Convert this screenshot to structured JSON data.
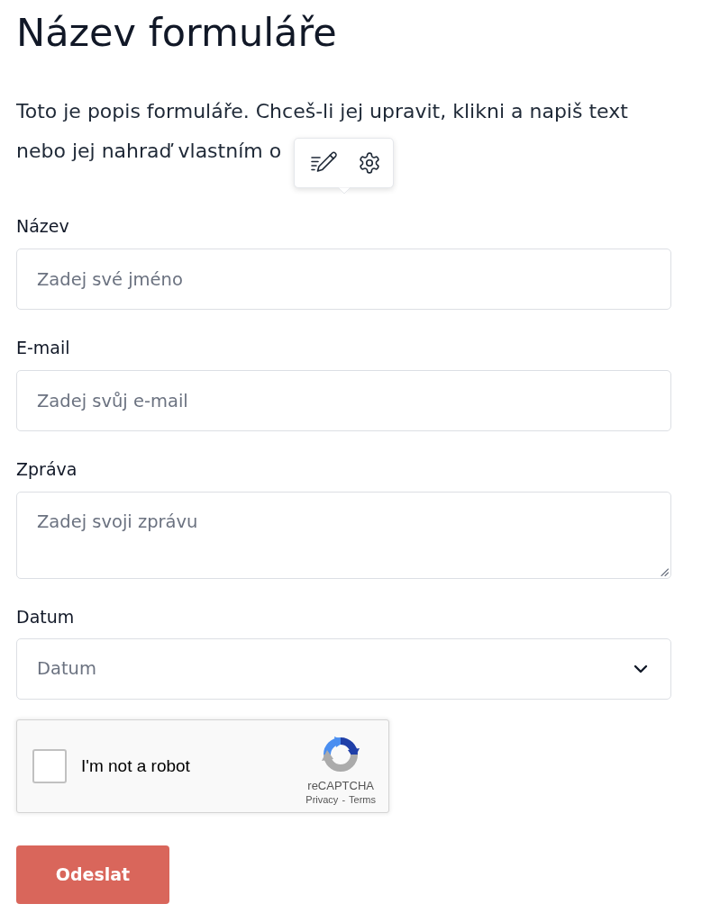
{
  "form": {
    "title": "Název formuláře",
    "description_lines": [
      "Toto je popis formuláře. Chceš-li jej upravit, klikni a napiš text",
      "nebo jej nahraď vlastním o"
    ]
  },
  "fields": [
    {
      "kind": "text",
      "label": "Název",
      "placeholder": "Zadej své jméno"
    },
    {
      "kind": "text",
      "label": "E-mail",
      "placeholder": "Zadej svůj e-mail"
    },
    {
      "kind": "textarea",
      "label": "Zpráva",
      "placeholder": "Zadej svoji zprávu"
    },
    {
      "kind": "select",
      "label": "Datum",
      "placeholder": "Datum"
    }
  ],
  "captcha": {
    "checked": false,
    "label": "I'm not a robot",
    "brand": "reCAPTCHA",
    "links": [
      "Privacy",
      "Terms"
    ],
    "separator": "-"
  },
  "submit": {
    "label": "Odeslat"
  }
}
